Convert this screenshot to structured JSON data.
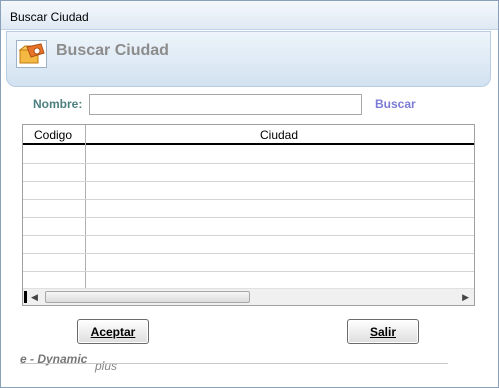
{
  "window": {
    "title": "Buscar Ciudad"
  },
  "banner": {
    "title": "Buscar Ciudad",
    "icon": "folder-search-icon"
  },
  "search": {
    "label": "Nombre:",
    "value": "",
    "placeholder": "",
    "button_label": "Buscar"
  },
  "grid": {
    "columns": [
      "Codigo",
      "Ciudad"
    ],
    "rows": [
      [
        "",
        ""
      ],
      [
        "",
        ""
      ],
      [
        "",
        ""
      ],
      [
        "",
        ""
      ],
      [
        "",
        ""
      ],
      [
        "",
        ""
      ],
      [
        "",
        ""
      ],
      [
        "",
        ""
      ]
    ]
  },
  "buttons": {
    "accept_label": "Aceptar",
    "exit_label": "Salir"
  },
  "footer": {
    "brand": "e - Dynamic",
    "brand_suffix": "plus"
  },
  "colors": {
    "label": "#4d8080",
    "link": "#7b7bd6",
    "banner_title": "#8c8c8c"
  }
}
